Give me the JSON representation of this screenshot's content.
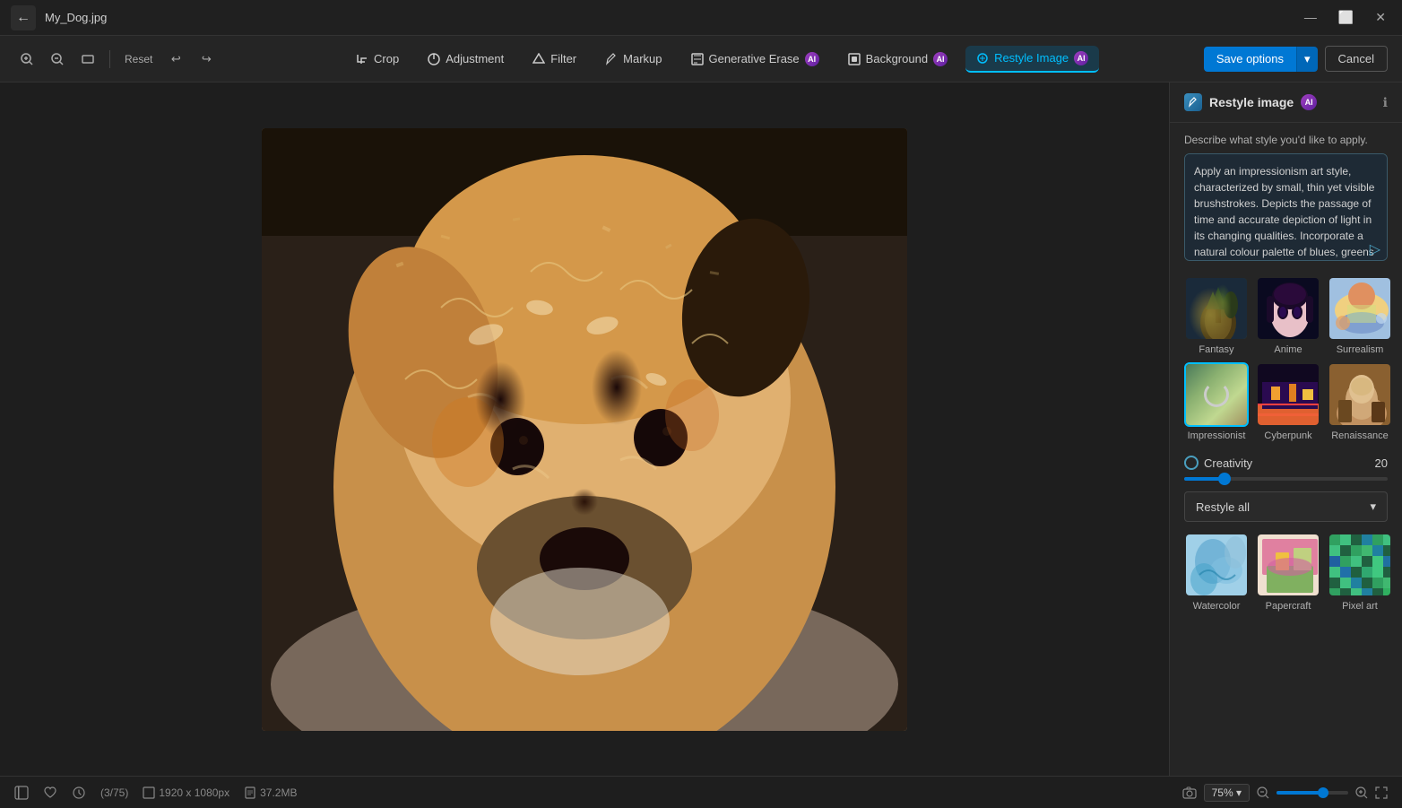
{
  "window": {
    "title": "My_Dog.jpg",
    "controls": {
      "minimize": "—",
      "maximize": "⬜",
      "close": "✕"
    }
  },
  "toolbar_left": {
    "zoom_in": "+",
    "zoom_out": "−",
    "aspect_ratio": "▣",
    "reset": "Reset",
    "undo": "↩",
    "redo": "↪"
  },
  "toolbar_center": {
    "tools": [
      {
        "id": "crop",
        "icon": "✂",
        "label": "Crop",
        "active": false
      },
      {
        "id": "adjustment",
        "icon": "◑",
        "label": "Adjustment",
        "active": false
      },
      {
        "id": "filter",
        "icon": "⬡",
        "label": "Filter",
        "active": false
      },
      {
        "id": "markup",
        "icon": "✏",
        "label": "Markup",
        "active": false
      },
      {
        "id": "generative_erase",
        "icon": "⬛",
        "label": "Generative Erase",
        "active": false,
        "ai": true
      },
      {
        "id": "background",
        "icon": "▦",
        "label": "Background",
        "active": false,
        "ai": true
      },
      {
        "id": "restyle_image",
        "icon": "♻",
        "label": "Restyle Image",
        "active": true,
        "ai": true
      }
    ]
  },
  "toolbar_right": {
    "save_options": "Save options",
    "save_arrow": "▾",
    "cancel": "Cancel"
  },
  "panel": {
    "title": "Restyle image",
    "describe_label": "Describe what style you'd like to apply.",
    "style_text": "Apply an impressionism art style, characterized by small, thin yet visible brushstrokes. Depicts the passage of time and accurate depiction of light in its changing qualities. Incorporate a natural colour palette of blues, greens and warm sun or clear night.",
    "send_icon": "▶",
    "styles": [
      {
        "id": "fantasy",
        "label": "Fantasy",
        "selected": false
      },
      {
        "id": "anime",
        "label": "Anime",
        "selected": false
      },
      {
        "id": "surrealism",
        "label": "Surrealism",
        "selected": false
      },
      {
        "id": "impressionist",
        "label": "Impressionist",
        "selected": true
      },
      {
        "id": "cyberpunk",
        "label": "Cyberpunk",
        "selected": false
      },
      {
        "id": "renaissance",
        "label": "Renaissance",
        "selected": false
      }
    ],
    "creativity": {
      "label": "Creativity",
      "value": "20",
      "percent": 20
    },
    "restyle_dropdown": "Restyle all",
    "bottom_styles": [
      {
        "id": "watercolor",
        "label": "Watercolor"
      },
      {
        "id": "papercraft",
        "label": "Papercraft"
      },
      {
        "id": "pixelart",
        "label": "Pixel art"
      }
    ]
  },
  "statusbar": {
    "panel_icon": "▣",
    "heart_icon": "♡",
    "clock_icon": "⏱",
    "frame_info": "(3/75)",
    "dimensions_icon": "⊡",
    "dimensions": "1920 x 1080px",
    "size_icon": "◫",
    "file_size": "37.2MB",
    "camera_icon": "⬚",
    "zoom_value": "75%",
    "zoom_dropdown": "▾"
  }
}
